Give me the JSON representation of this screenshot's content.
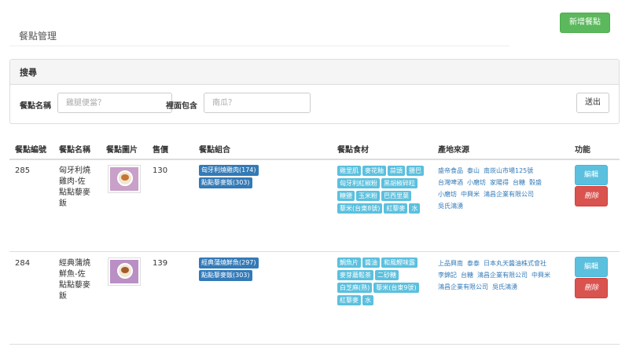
{
  "page": {
    "title": "餐點管理",
    "add_button": "新增餐點"
  },
  "search": {
    "heading": "搜尋",
    "name_label": "餐點名稱",
    "name_placeholder": "雞腿便當？",
    "contains_label": "裡面包含",
    "contains_placeholder": "南瓜？",
    "search_button": "送出"
  },
  "table": {
    "headers": [
      "餐點編號",
      "餐點名稱",
      "餐點圖片",
      "售價",
      "餐點組合",
      "餐點食材",
      "產地來源",
      "功能"
    ],
    "edit_label": "編輯",
    "delete_label": "刪除",
    "rows": [
      {
        "id": "285",
        "name": [
          "匈牙利燒",
          "雞肉-佐",
          "點點藜麥",
          "飯"
        ],
        "price": "130",
        "combos": [
          "匈牙利燒雞肉(174)",
          "點點藜麥飯(303)"
        ],
        "ingredients": [
          "雞里肌",
          "麥花釉",
          "蒜頭",
          "鹽巴",
          "匈牙利紅椒粉",
          "黑胡椒碎粒",
          "糖鹽",
          "玉米粉",
          "巴西里葉",
          "藜米(台東8號)",
          "紅藜麥",
          "水"
        ],
        "origins": [
          "盛帝食品",
          "泰山",
          "南崁山市場125號",
          "台灣啤酒",
          "小磨坊",
          "家陽得",
          "台糖",
          "穀盛",
          "小磨坊",
          "中興米",
          "鴻昌企業有限公司",
          "吳氏鴻湧"
        ]
      },
      {
        "id": "284",
        "name": [
          "經典蒲燒",
          "鮮魚-佐",
          "點點藜麥",
          "飯"
        ],
        "price": "139",
        "combos": [
          "經典蒲燒鮮魚(297)",
          "點點藜麥飯(303)"
        ],
        "ingredients": [
          "鯛魚片",
          "醬油",
          "和風鰹味露",
          "麥芽蘑鬆茶",
          "二砂糖",
          "白芝麻(熟)",
          "藜米(台東9號)",
          "紅藜麥",
          "水"
        ],
        "origins": [
          "上品興南",
          "泰泰",
          "日本丸天醬油株式會社",
          "李錦記",
          "台糖",
          "鴻昌企業有限公司",
          "中興米",
          "鴻昌企業有限公司",
          "吳氏鴻湧"
        ]
      }
    ]
  }
}
